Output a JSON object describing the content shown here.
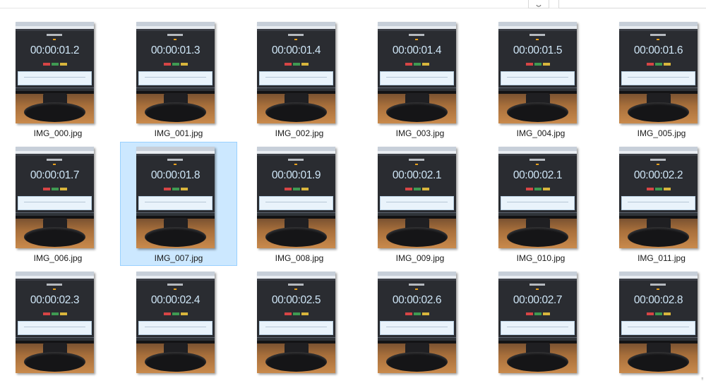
{
  "toolbar": {
    "refresh_icon": "refresh-icon",
    "search_icon": "search-field"
  },
  "colors": {
    "selection_bg": "#cce8ff",
    "selection_border": "#99d1ff",
    "stopwatch_digits": "#cfe6f7"
  },
  "files": [
    {
      "name": "IMG_000.jpg",
      "time": "00:00:01.2",
      "selected": false
    },
    {
      "name": "IMG_001.jpg",
      "time": "00:00:01.3",
      "selected": false
    },
    {
      "name": "IMG_002.jpg",
      "time": "00:00:01.4",
      "selected": false
    },
    {
      "name": "IMG_003.jpg",
      "time": "00:00:01.4",
      "selected": false
    },
    {
      "name": "IMG_004.jpg",
      "time": "00:00:01.5",
      "selected": false
    },
    {
      "name": "IMG_005.jpg",
      "time": "00:00:01.6",
      "selected": false
    },
    {
      "name": "IMG_006.jpg",
      "time": "00:00:01.7",
      "selected": false
    },
    {
      "name": "IMG_007.jpg",
      "time": "00:00:01.8",
      "selected": true
    },
    {
      "name": "IMG_008.jpg",
      "time": "00:00:01.9",
      "selected": false
    },
    {
      "name": "IMG_009.jpg",
      "time": "00:00:02.1",
      "selected": false
    },
    {
      "name": "IMG_010.jpg",
      "time": "00:00:02.1",
      "selected": false
    },
    {
      "name": "IMG_011.jpg",
      "time": "00:00:02.2",
      "selected": false
    },
    {
      "name": "",
      "time": "00:00:02.3",
      "selected": false
    },
    {
      "name": "",
      "time": "00:00:02.4",
      "selected": false
    },
    {
      "name": "",
      "time": "00:00:02.5",
      "selected": false
    },
    {
      "name": "",
      "time": "00:00:02.6",
      "selected": false
    },
    {
      "name": "",
      "time": "00:00:02.7",
      "selected": false
    },
    {
      "name": "",
      "time": "00:00:02.8",
      "selected": false
    }
  ]
}
